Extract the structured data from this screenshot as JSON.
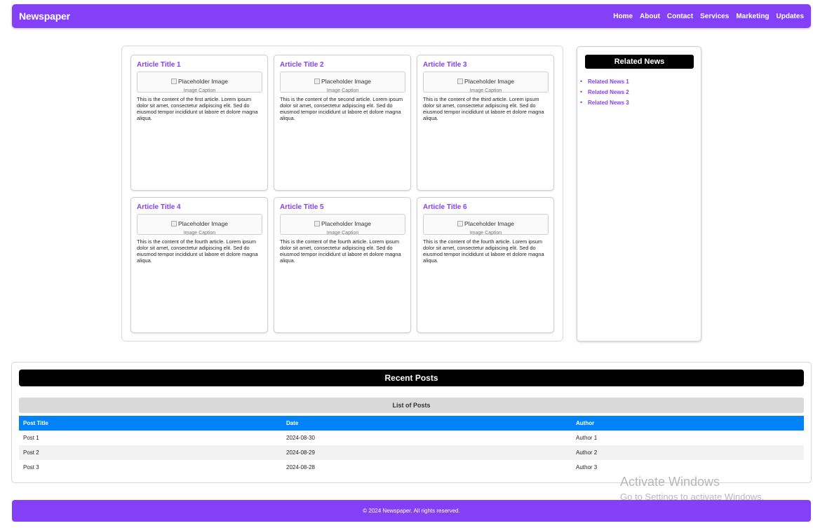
{
  "header": {
    "brand": "Newspaper",
    "nav": [
      "Home",
      "About",
      "Contact",
      "Services",
      "Marketing",
      "Updates"
    ]
  },
  "articles": [
    {
      "title": "Article Title 1",
      "image_alt": "Placeholder Image",
      "caption": "Image Caption",
      "body": "This is the content of the first article. Lorem ipsum dolor sit amet, consectetur adipiscing elit. Sed do eiusmod tempor incididunt ut labore et dolore magna aliqua."
    },
    {
      "title": "Article Title 2",
      "image_alt": "Placeholder Image",
      "caption": "Image Caption",
      "body": "This is the content of the second article. Lorem ipsum dolor sit amet, consectetur adipiscing elit. Sed do eiusmod tempor incididunt ut labore et dolore magna aliqua."
    },
    {
      "title": "Article Title 3",
      "image_alt": "Placeholder Image",
      "caption": "Image Caption",
      "body": "This is the content of the third article. Lorem ipsum dolor sit amet, consectetur adipiscing elit. Sed do eiusmod tempor incididunt ut labore et dolore magna aliqua."
    },
    {
      "title": "Article Title 4",
      "image_alt": "Placeholder Image",
      "caption": "Image Caption",
      "body": "This is the content of the fourth article. Lorem ipsum dolor sit amet, consectetur adipiscing elit. Sed do eiusmod tempor incididunt ut labore et dolore magna aliqua."
    },
    {
      "title": "Article Title 5",
      "image_alt": "Placeholder Image",
      "caption": "Image Caption",
      "body": "This is the content of the fourth article. Lorem ipsum dolor sit amet, consectetur adipiscing elit. Sed do eiusmod tempor incididunt ut labore et dolore magna aliqua."
    },
    {
      "title": "Article Title 6",
      "image_alt": "Placeholder Image",
      "caption": "Image Caption",
      "body": "This is the content of the fourth article. Lorem ipsum dolor sit amet, consectetur adipiscing elit. Sed do eiusmod tempor incididunt ut labore et dolore magna aliqua."
    }
  ],
  "related": {
    "title": "Related News",
    "items": [
      "Related News 1",
      "Related News 2",
      "Related News 3"
    ]
  },
  "recent": {
    "title": "Recent Posts",
    "caption": "List of Posts",
    "columns": [
      "Post Title",
      "Date",
      "Author"
    ],
    "rows": [
      [
        "Post 1",
        "2024-08-30",
        "Author 1"
      ],
      [
        "Post 2",
        "2024-08-29",
        "Author 2"
      ],
      [
        "Post 3",
        "2024-08-28",
        "Author 3"
      ]
    ]
  },
  "watermark": {
    "line1": "Activate Windows",
    "line2": "Go to Settings to activate Windows."
  },
  "footer": {
    "text": "© 2024 Newspaper. All rights reserved."
  },
  "colors": {
    "brand": "#8440f7",
    "table_header": "#0083f8",
    "header_bar": "#000000"
  }
}
